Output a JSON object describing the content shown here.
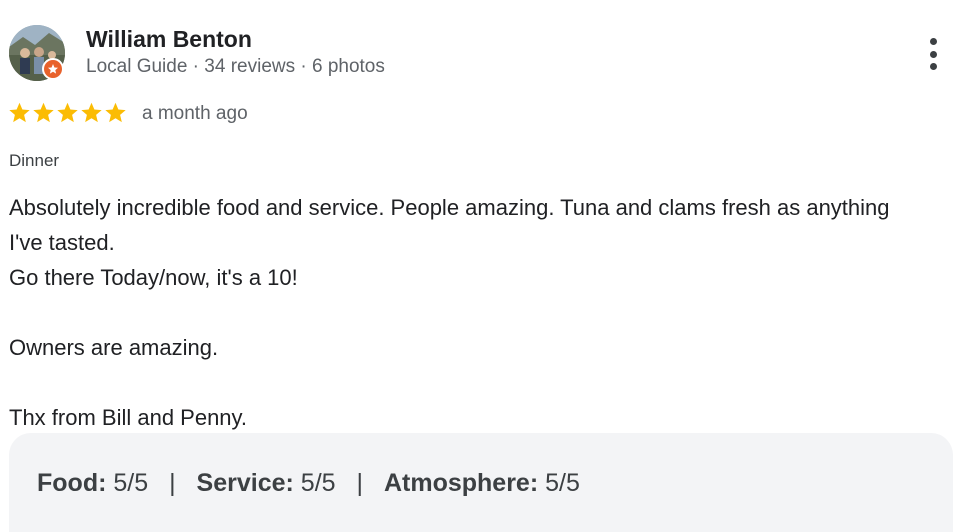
{
  "reviewer": {
    "name": "William Benton",
    "meta": "Local Guide · 34 reviews · 6 photos",
    "avatar_icon": "reviewer-photo",
    "badge_icon": "local-guide-star-icon",
    "badge_color": "#e8622c"
  },
  "rating": {
    "stars": 5,
    "max_stars": 5,
    "star_color": "#fbbc04",
    "time_ago": "a month ago"
  },
  "meal_type": "Dinner",
  "review_text": {
    "line1": "Absolutely incredible food and service. People amazing. Tuna and clams fresh as anything I've tasted.",
    "line2": "Go there Today/now, it's a 10!",
    "line3": "Owners are amazing.",
    "line4": "Thx from Bill and Penny."
  },
  "sub_ratings": [
    {
      "label": "Food:",
      "value": "5/5"
    },
    {
      "label": "Service:",
      "value": "5/5"
    },
    {
      "label": "Atmosphere:",
      "value": "5/5"
    }
  ],
  "separator": "|",
  "menu_icon": "more-vert-icon"
}
